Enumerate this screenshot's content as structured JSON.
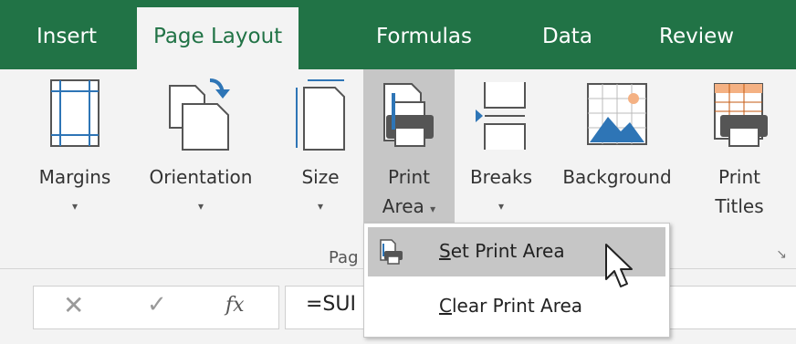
{
  "tabs": [
    {
      "label": "Insert"
    },
    {
      "label": "Page Layout"
    },
    {
      "label": "Formulas"
    },
    {
      "label": "Data"
    },
    {
      "label": "Review"
    }
  ],
  "ribbon": {
    "buttons": [
      {
        "label": "Margins",
        "icon": "margins-icon"
      },
      {
        "label": "Orientation",
        "icon": "orientation-icon"
      },
      {
        "label": "Size",
        "icon": "size-icon"
      },
      {
        "label": "Print",
        "label2": "Area",
        "icon": "print-area-icon"
      },
      {
        "label": "Breaks",
        "icon": "breaks-icon"
      },
      {
        "label": "Background",
        "icon": "background-icon"
      },
      {
        "label": "Print",
        "label2": "Titles",
        "icon": "print-titles-icon"
      }
    ],
    "group_label": "Pag",
    "dropdown_caret": "▾"
  },
  "menu": {
    "items": [
      {
        "label_prefix": "",
        "accel": "S",
        "label_rest": "et Print Area",
        "icon": "set-print-area-icon"
      },
      {
        "label_prefix": "",
        "accel": "C",
        "label_rest": "lear Print Area"
      }
    ]
  },
  "formula_bar": {
    "cancel_glyph": "✕",
    "enter_glyph": "✓",
    "fx_glyph": "fx",
    "formula_text": "=SUI"
  },
  "colors": {
    "accent": "#217346",
    "ribbon_bg": "#f3f3f3",
    "pressed": "#c6c6c6"
  }
}
